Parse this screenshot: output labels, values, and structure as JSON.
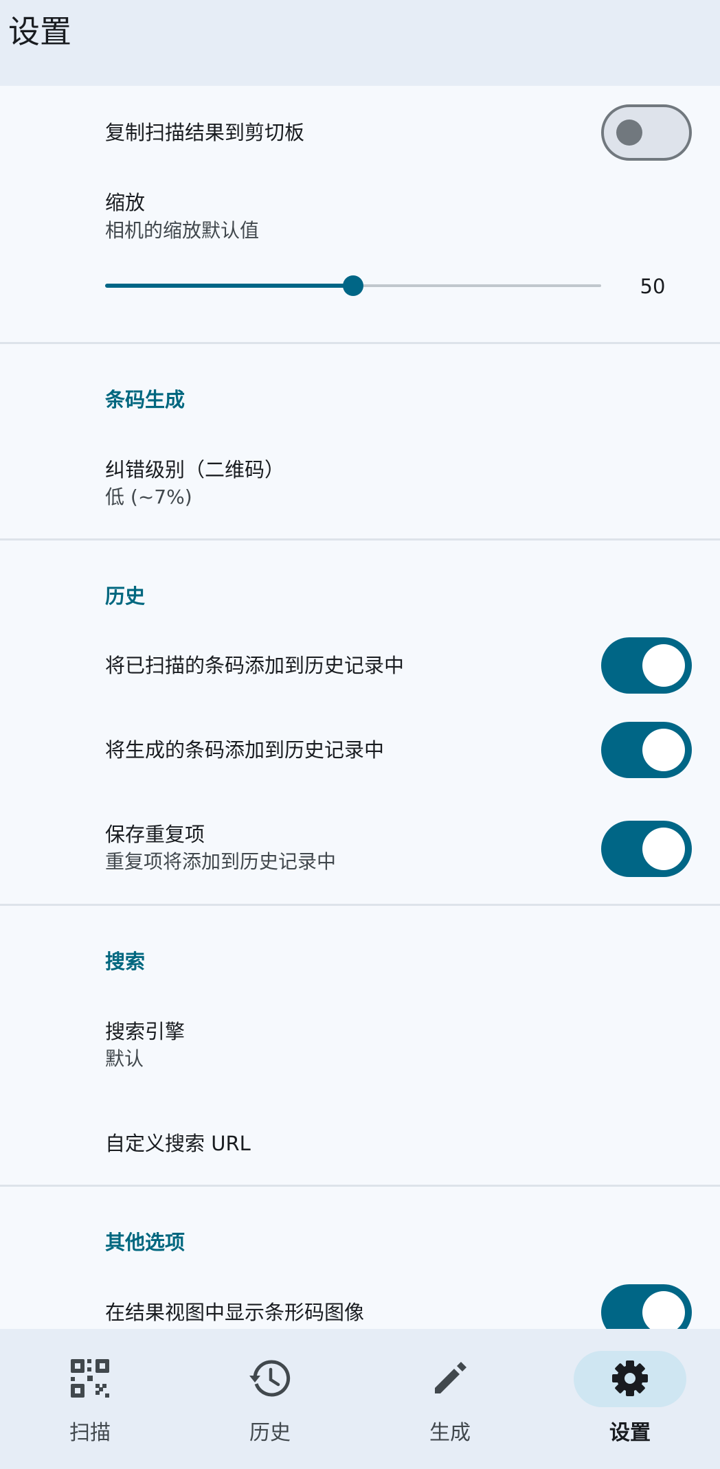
{
  "header": {
    "title": "设置"
  },
  "settings": {
    "copy_to_clipboard": {
      "label": "复制扫描结果到剪切板",
      "enabled": false
    },
    "zoom": {
      "title": "缩放",
      "subtitle": "相机的缩放默认值",
      "value": "50",
      "fraction": 0.5
    },
    "barcode_generation": {
      "header": "条码生成",
      "error_correction": {
        "title": "纠错级别（二维码）",
        "subtitle": "低 (~7%)"
      }
    },
    "history": {
      "header": "历史",
      "add_scanned": {
        "label": "将已扫描的条码添加到历史记录中",
        "enabled": true
      },
      "add_generated": {
        "label": "将生成的条码添加到历史记录中",
        "enabled": true
      },
      "save_duplicates": {
        "title": "保存重复项",
        "subtitle": "重复项将添加到历史记录中",
        "enabled": true
      }
    },
    "search": {
      "header": "搜索",
      "engine": {
        "title": "搜索引擎",
        "subtitle": "默认"
      },
      "custom_url": {
        "title": "自定义搜索 URL"
      }
    },
    "other": {
      "header": "其他选项",
      "show_barcode_image": {
        "label": "在结果视图中显示条形码图像",
        "enabled": true
      }
    }
  },
  "navbar": {
    "items": [
      {
        "label": "扫描",
        "icon": "qr-scan-icon",
        "active": false
      },
      {
        "label": "历史",
        "icon": "history-icon",
        "active": false
      },
      {
        "label": "生成",
        "icon": "pencil-icon",
        "active": false
      },
      {
        "label": "设置",
        "icon": "gear-icon",
        "active": true
      }
    ]
  },
  "colors": {
    "accent": "#006686",
    "section_header": "#00677f",
    "background": "#f6f9fd",
    "bar_background": "#e6edf6",
    "active_pill": "#cfe6f2"
  }
}
